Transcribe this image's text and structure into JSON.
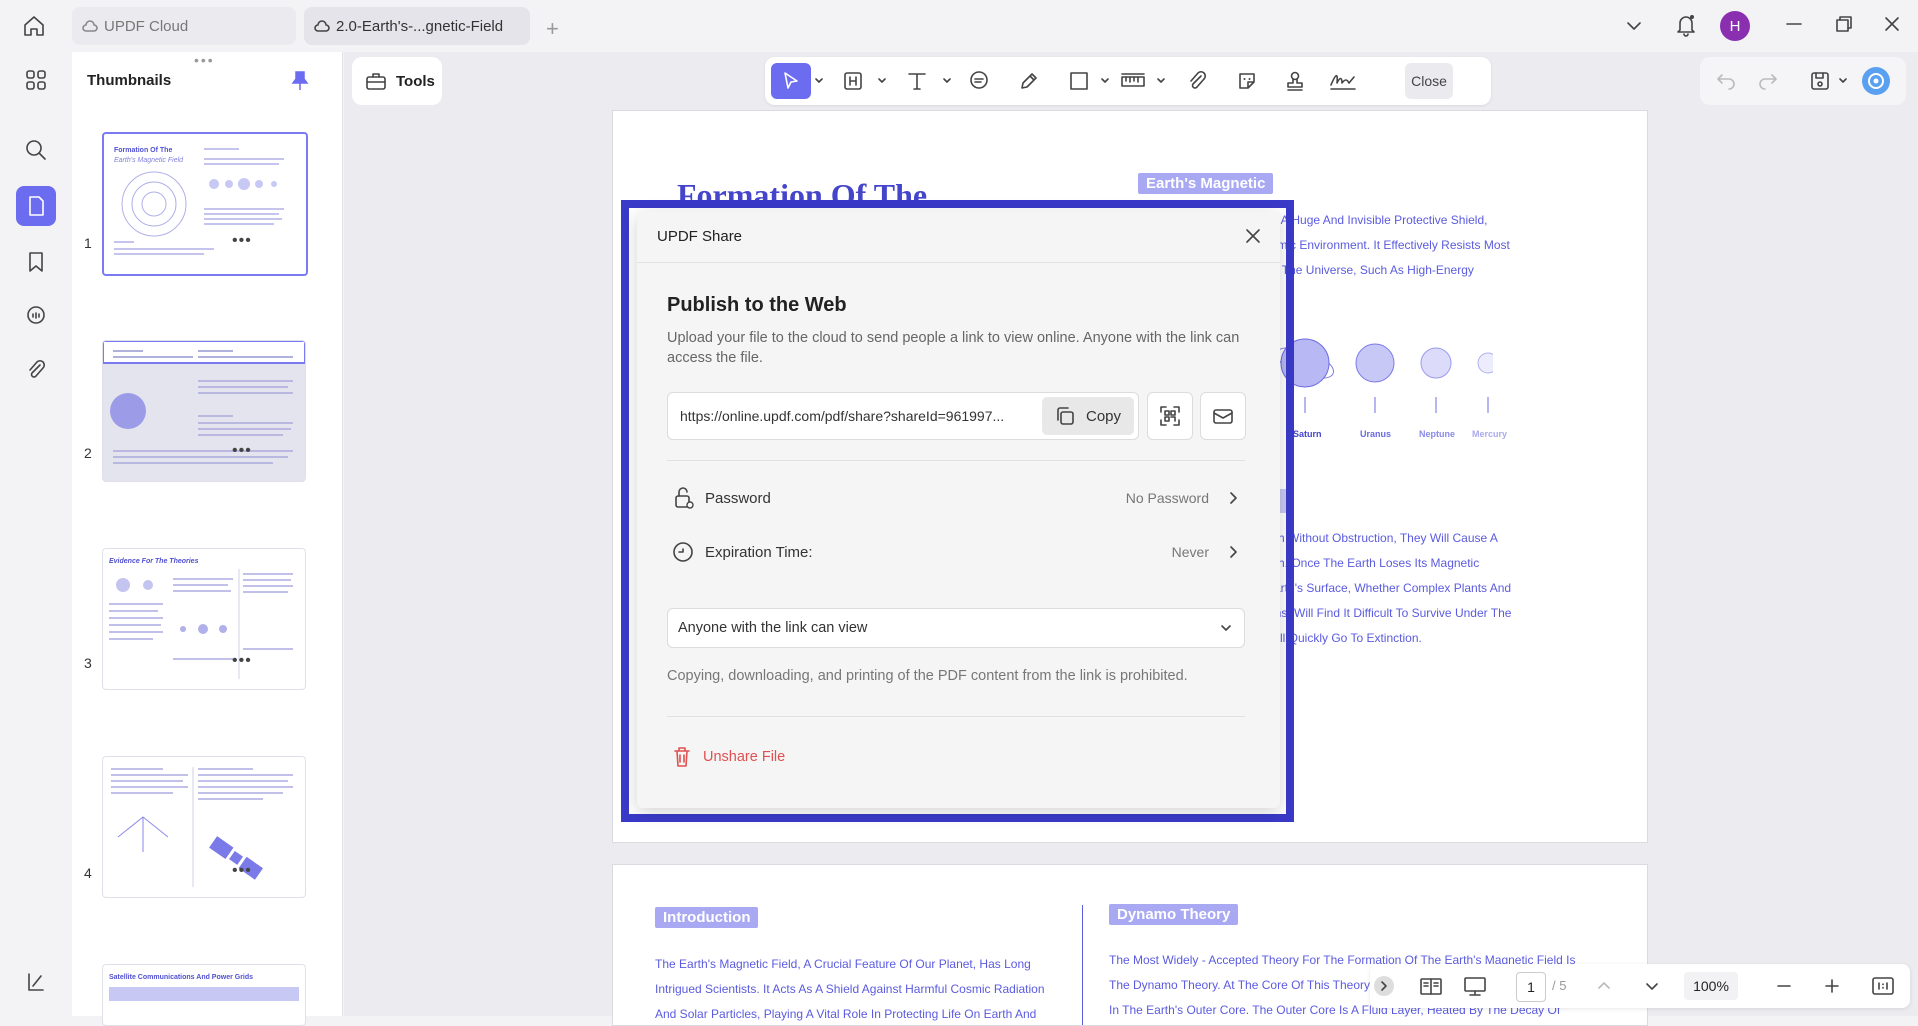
{
  "titlebar": {
    "tabs": [
      {
        "label": "UPDF Cloud"
      },
      {
        "label": "2.0-Earth's-...gnetic-Field"
      }
    ],
    "avatar_letter": "H"
  },
  "sidebar": {
    "title": "Thumbnails",
    "pages": [
      "1",
      "2",
      "3",
      "4"
    ]
  },
  "tools_label": "Tools",
  "toolbar": {
    "close_label": "Close"
  },
  "page1": {
    "title_partial": "Formation Of The",
    "tag1": "Earth's Magnetic",
    "lines1": [
      "Like A Huge And Invisible Protective Shield,",
      "Cosmic Environment. It Effectively Resists Most",
      "ts In The Universe, Such As High-Energy"
    ],
    "planets": [
      "Saturn",
      "Uranus",
      "Neptune",
      "Mercury"
    ],
    "lines2": [
      "Earth Without Obstruction, They Will Cause A",
      "Earth. Once The Earth Loses Its Magnetic",
      "e Earth's Surface, Whether Complex Plants And",
      "nisms, Will Find It Difficult To Survive Under The",
      "d Will Quickly Go To Extinction."
    ]
  },
  "page2": {
    "intro_tag": "Introduction",
    "intro_lines": [
      "The Earth's Magnetic Field, A Crucial Feature Of Our Planet, Has Long",
      "Intrigued Scientists. It Acts As A Shield Against Harmful Cosmic Radiation",
      "And Solar Particles, Playing A Vital Role In Protecting Life On Earth And"
    ],
    "dynamo_tag": "Dynamo Theory",
    "dynamo_lines": [
      "The Most Widely - Accepted Theory For The Formation Of The Earth's Magnetic Field Is",
      "The Dynamo Theory. At The Core Of This Theory",
      "In The Earth's Outer Core. The Outer Core Is A Fluid Layer, Heated By The Decay Of"
    ]
  },
  "dialog": {
    "title": "UPDF Share",
    "heading": "Publish to the Web",
    "description": "Upload your file to the cloud to send people a link to view online. Anyone with the link can access the file.",
    "link": "https://online.updf.com/pdf/share?shareId=961997...",
    "copy_label": "Copy",
    "password_label": "Password",
    "password_value": "No Password",
    "expiration_label": "Expiration Time:",
    "expiration_value": "Never",
    "permission": "Anyone with the link can view",
    "notice": "Copying, downloading, and printing of the PDF content from the link is prohibited.",
    "unshare_label": "Unshare File"
  },
  "bottombar": {
    "page_current": "1",
    "page_total": "/ 5",
    "zoom": "100%"
  },
  "colors": {
    "accent": "#6c6cf0",
    "highlight": "#3a3ac9",
    "danger": "#e05050"
  }
}
